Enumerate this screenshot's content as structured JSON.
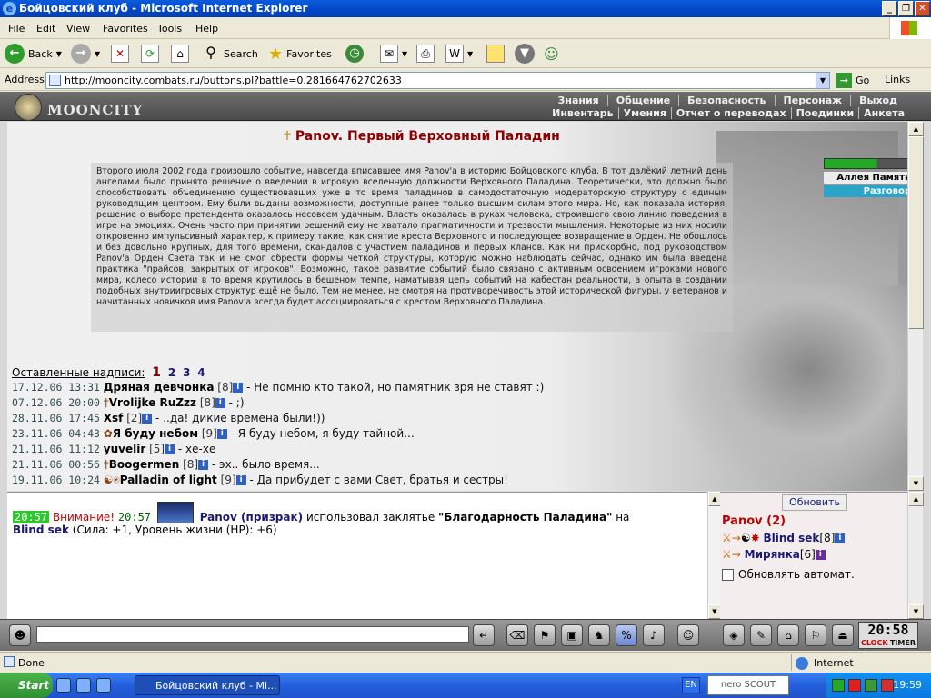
{
  "window": {
    "title": "Бойцовский клуб - Microsoft Internet Explorer"
  },
  "menu": [
    "File",
    "Edit",
    "View",
    "Favorites",
    "Tools",
    "Help"
  ],
  "toolbar": {
    "back": "Back",
    "search": "Search",
    "favorites": "Favorites"
  },
  "address": {
    "label": "Address",
    "url": "http://mooncity.combats.ru/buttons.pl?battle=0.281664762702633",
    "go": "Go",
    "links": "Links"
  },
  "game": {
    "logo": "MOONCITY",
    "nav_top": [
      "Знания",
      "Общение",
      "Безопасность",
      "Персонаж",
      "Выход"
    ],
    "nav_bottom": [
      "Инвентарь",
      "Умения",
      "Отчет о переводах",
      "Поединки",
      "Анкета"
    ],
    "heading": "Panov. Первый Верховный Паладин",
    "story": "Второго июля 2002 года произошло событие, навсегда вписавшее имя Panov'а в историю Бойцовского клуба. В тот далёкий летний день ангелами было принято решение о введении в игровую вселенную должности Верховного Паладина. Теоретически, это должно было способствовать объединению существовавших уже в то время паладинов в самодостаточную модераторскую структуру с единым руководящим центром. Ему были выданы возможности, доступные ранее только высшим силам этого мира. Но, как показала история, решение о выборе претендента оказалось несовсем удачным. Власть оказалась в руках человека, строившего свою линию поведения в игре на эмоциях. Очень часто при принятии решений ему не хватало прагматичности и трезвости мышления. Некоторые из них носили откровенно импульсивный характер, к примеру такие, как снятие креста Верховного и последующее возвращение в Орден. Не обошлось и без довольно крупных, для того времени, скандалов с участием паладинов и первых кланов. Как ни прискорбно, под руководством Panov'а Орден Света так и не смог обрести формы четкой структуры, которую можно наблюдать сейчас, однако им была введена практика \"прайсов, закрытых от игроков\". Возможно, такое развитие событий было связано с активным освоением игроками нового мира, колесо истории в то время крутилось в бешеном темпе, наматывая цепь событий на кабестан реальности, а опыта в создании подобных внутриигровых структур ещё не было. Тем не менее, не смотря на противоречивость этой исторической фигуры, у ветеранов и начитанных новичков имя Panov'а всегда будет ассоциироваться с крестом Верховного Паладина.",
    "side": {
      "alley": "Аллея Памяти",
      "talk": "Разговор"
    },
    "inscriptions_label": "Оставленные надписи:",
    "pages": [
      "1",
      "2",
      "3",
      "4"
    ],
    "inscriptions": [
      {
        "date": "17.12.06 13:31",
        "icon": "",
        "name": "Дряная девчонка",
        "level": "[8]",
        "text": "- Не помню кто такой, но памятник зря не ставят :)"
      },
      {
        "date": "07.12.06 20:00",
        "icon": "†",
        "name": "Vrolijke RuZzz",
        "level": "[8]",
        "text": "- ;)"
      },
      {
        "date": "28.11.06 17:45",
        "icon": "",
        "name": "Xsf",
        "level": "[2]",
        "text": "- ..да! дикие времена были!))"
      },
      {
        "date": "23.11.06 04:43",
        "icon": "✿",
        "name": "Я буду небом",
        "level": "[9]",
        "text": "- Я буду небом, я буду тайной..."
      },
      {
        "date": "21.11.06 11:12",
        "icon": "",
        "name": "yuvelir",
        "level": "[5]",
        "text": "- хе-хе"
      },
      {
        "date": "21.11.06 00:56",
        "icon": "†",
        "name": "Boogermen",
        "level": "[8]",
        "text": "- эх.. было время..."
      },
      {
        "date": "19.11.06 10:24",
        "icon": "☯⍟",
        "name": "Palladin of light",
        "level": "[9]",
        "text": "- Да прибудет с вами Свет, братья и сестры!"
      }
    ],
    "chat": {
      "time1": "20:57",
      "warning": "Внимание!",
      "time2": "20:57",
      "who": "Panov (призрак)",
      "action": "использовал заклятье",
      "spell": "\"Благодарность Паладина\"",
      "on": "на",
      "target": "Blind sek",
      "effect": "(Сила: +1, Уровень жизни (HP): +6)"
    },
    "online": {
      "refresh": "Обновить",
      "room": "Panov (2)",
      "players": [
        {
          "name": "Blind sek",
          "level": "[8]"
        },
        {
          "name": "Мирянка",
          "level": "[6]"
        }
      ],
      "auto": "Обновлять автомат."
    },
    "clock": {
      "time": "20:58",
      "clock_label": "CLOCK",
      "timer_label": "TIMER"
    }
  },
  "status": {
    "done": "Done",
    "zone": "Internet"
  },
  "taskbar": {
    "start": "Start",
    "item": "Бойцовский клуб - Mi...",
    "lang": "EN",
    "scout": "nero SCOUT",
    "time": "19:59"
  }
}
